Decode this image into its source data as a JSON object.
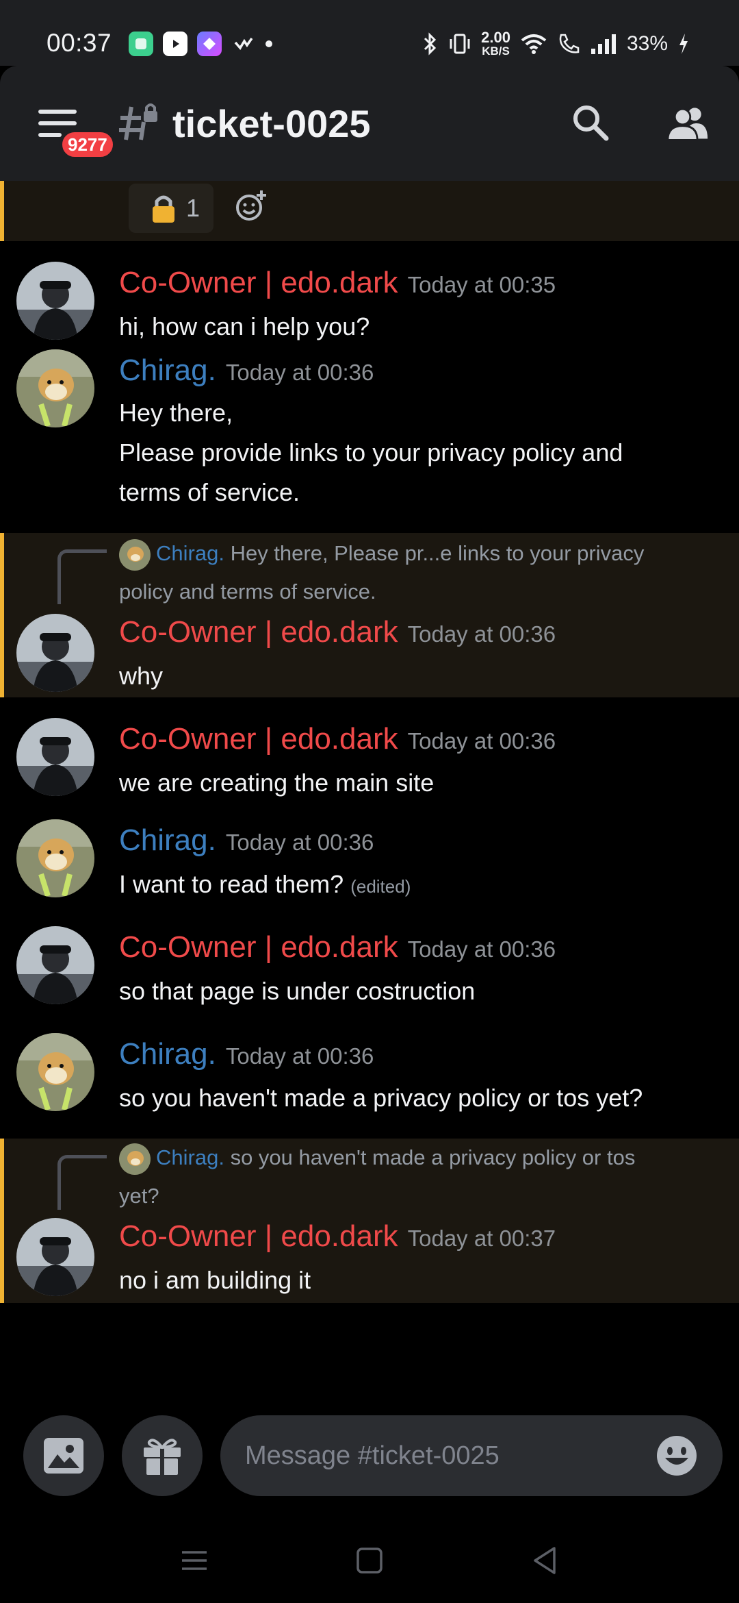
{
  "status_bar": {
    "time": "00:37",
    "net_speed_value": "2.00",
    "net_speed_unit": "KB/S",
    "battery": "33%",
    "icons": [
      "app-green-icon",
      "youtube-icon",
      "app-purple-icon",
      "check-icon",
      "bluetooth-icon",
      "vibrate-icon",
      "wifi-icon",
      "call-icon",
      "signal-icon",
      "charging-icon"
    ]
  },
  "header": {
    "badge_count": "9277",
    "channel_name": "ticket-0025",
    "icons": [
      "menu-icon",
      "locked-channel-icon",
      "search-icon",
      "members-icon"
    ]
  },
  "reactions": {
    "lock_count": "1",
    "lock_emoji_color": "#f0b232"
  },
  "messages": [
    {
      "author": "Co-Owner | edo.dark",
      "timestamp": "Today at 00:35",
      "lines": [
        "hi, how can i help you?"
      ]
    },
    {
      "author": "Chirag.",
      "timestamp": "Today at 00:36",
      "lines": [
        "Hey there,",
        "Please provide links to your privacy policy and",
        "terms of service."
      ]
    },
    {
      "reply_author": "Chirag.",
      "reply_text_1": "Hey there, Please pr...e links to your privacy",
      "reply_text_2": "policy and terms of service.",
      "author": "Co-Owner | edo.dark",
      "timestamp": "Today at 00:36",
      "lines": [
        "why"
      ]
    },
    {
      "author": "Co-Owner | edo.dark",
      "timestamp": "Today at 00:36",
      "lines": [
        "we are creating the main site"
      ]
    },
    {
      "author": "Chirag.",
      "timestamp": "Today at 00:36",
      "lines": [
        "I want to read them?"
      ],
      "edited": "(edited)"
    },
    {
      "author": "Co-Owner | edo.dark",
      "timestamp": "Today at 00:36",
      "lines": [
        "so that page is under costruction"
      ]
    },
    {
      "author": "Chirag.",
      "timestamp": "Today at 00:36",
      "lines": [
        "so you haven't made a privacy policy or tos yet?"
      ]
    },
    {
      "reply_author": "Chirag.",
      "reply_text_1": "so you haven't made a privacy policy or tos",
      "reply_text_2": "yet?",
      "author": "Co-Owner | edo.dark",
      "timestamp": "Today at 00:37",
      "lines": [
        "no i am building it"
      ]
    }
  ],
  "composer": {
    "placeholder": "Message #ticket-0025",
    "icons": [
      "image-icon",
      "gift-icon",
      "emoji-icon"
    ]
  },
  "colors": {
    "owner_name": "#f04a4a",
    "member_name": "#3d7fbf",
    "mention_highlight": "#f0b232",
    "background": "#000000",
    "header": "#1e1f22"
  }
}
